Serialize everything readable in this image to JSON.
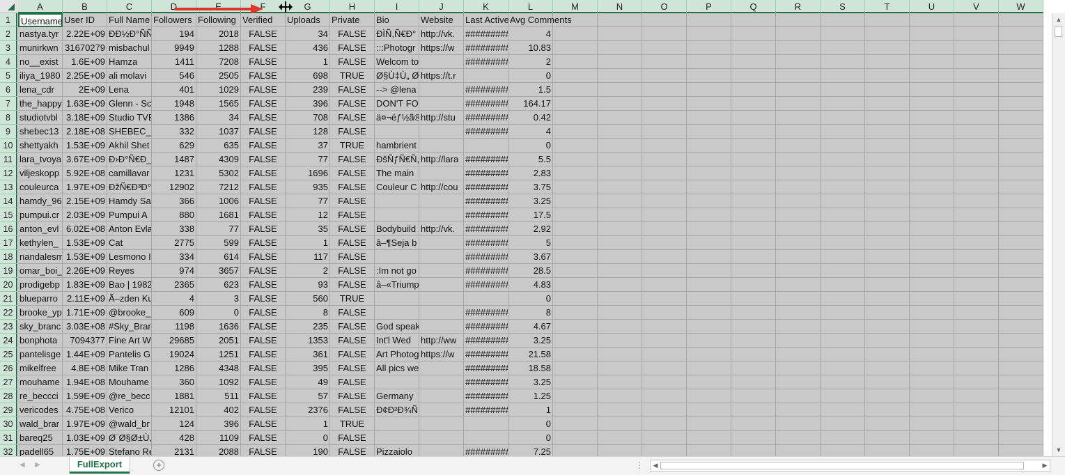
{
  "workbook": {
    "sheet_tab": "FullExport",
    "add_sheet_label": "+",
    "tab_dots": "⋮",
    "accent": "#217346"
  },
  "columns": [
    "A",
    "B",
    "C",
    "D",
    "E",
    "F",
    "G",
    "H",
    "I",
    "J",
    "K",
    "L",
    "M",
    "N",
    "O",
    "P",
    "Q",
    "R",
    "S",
    "T",
    "U",
    "V",
    "W"
  ],
  "headers": [
    "Username",
    "User ID",
    "Full Name",
    "Followers",
    "Following",
    "Verified",
    "Uploads",
    "Private",
    "Bio",
    "Website",
    "Last Active",
    "Avg Comments"
  ],
  "rows": [
    [
      "nastya.tyr",
      "2.22E+09",
      "ÐÐ½Ð°ÑÑ",
      "194",
      "2018",
      "FALSE",
      "34",
      "FALSE",
      "ÐÌÑ,Ñ€Ð°",
      "http://vk.",
      "#########",
      "4"
    ],
    [
      "munirkwn",
      "31670279",
      "misbachul",
      "9949",
      "1288",
      "FALSE",
      "436",
      "FALSE",
      ":::Photogr",
      "https://w",
      "#########",
      "10.83"
    ],
    [
      "no__exist",
      "1.6E+09",
      "Hamza",
      "1411",
      "7208",
      "FALSE",
      "1",
      "FALSE",
      "Welcom to",
      "",
      "#########",
      "2"
    ],
    [
      "iliya_1980",
      "2.25E+09",
      "ali molavi",
      "546",
      "2505",
      "FALSE",
      "698",
      "TRUE",
      "Ø§Ù‡Ù„ Ø",
      "https://t.r",
      "",
      "0"
    ],
    [
      "lena_cdr",
      "2E+09",
      "Lena",
      "401",
      "1029",
      "FALSE",
      "239",
      "FALSE",
      "--> @lena",
      "",
      "#########",
      "1.5"
    ],
    [
      "the_happy",
      "1.63E+09",
      "Glenn - Sc",
      "1948",
      "1565",
      "FALSE",
      "396",
      "FALSE",
      "DON'T FOL",
      "",
      "#########",
      "164.17"
    ],
    [
      "studiotvbl",
      "3.18E+09",
      "Studio TVB",
      "1386",
      "34",
      "FALSE",
      "708",
      "FALSE",
      "ä¤¬éƒ½ã®ä",
      "http://stu",
      "#########",
      "0.42"
    ],
    [
      "shebec13",
      "2.18E+08",
      "SHEBEC_â",
      "332",
      "1037",
      "FALSE",
      "128",
      "FALSE",
      "",
      "",
      "#########",
      "4"
    ],
    [
      "shettyakh",
      "1.53E+09",
      "Akhil Shet",
      "629",
      "635",
      "FALSE",
      "37",
      "TRUE",
      "hambrient",
      "",
      "",
      "0"
    ],
    [
      "lara_tvoya",
      "3.67E+09",
      "Ð›Ð°Ñ€Ð_",
      "1487",
      "4309",
      "FALSE",
      "77",
      "FALSE",
      "ÐšÑƒÑ€Ñ,",
      "http://lara",
      "#########",
      "5.5"
    ],
    [
      "viljeskopp",
      "5.92E+08",
      "camillavar",
      "1231",
      "5302",
      "FALSE",
      "1696",
      "FALSE",
      "The main",
      "",
      "#########",
      "2.83"
    ],
    [
      "couleurca",
      "1.97E+09",
      "ÐžÑ€Ð³Ð°",
      "12902",
      "7212",
      "FALSE",
      "935",
      "FALSE",
      "Couleur C",
      "http://cou",
      "#########",
      "3.75"
    ],
    [
      "hamdy_96",
      "2.15E+09",
      "Hamdy Sa",
      "366",
      "1006",
      "FALSE",
      "77",
      "FALSE",
      "",
      "",
      "#########",
      "3.25"
    ],
    [
      "pumpui.cr",
      "2.03E+09",
      "Pumpui A",
      "880",
      "1681",
      "FALSE",
      "12",
      "FALSE",
      "",
      "",
      "#########",
      "17.5"
    ],
    [
      "anton_evl",
      "6.02E+08",
      "Anton Evla",
      "338",
      "77",
      "FALSE",
      "35",
      "FALSE",
      "Bodybuild",
      "http://vk.",
      "#########",
      "2.92"
    ],
    [
      "kethylen_",
      "1.53E+09",
      "Cat",
      "2775",
      "599",
      "FALSE",
      "1",
      "FALSE",
      "â–¶Seja b",
      "",
      "#########",
      "5"
    ],
    [
      "nandalesm",
      "1.53E+09",
      "Lesmono I",
      "334",
      "614",
      "FALSE",
      "117",
      "FALSE",
      "",
      "",
      "#########",
      "3.67"
    ],
    [
      "omar_boi_",
      "2.26E+09",
      "Reyes",
      "974",
      "3657",
      "FALSE",
      "2",
      "FALSE",
      ":Im not go",
      "",
      "#########",
      "28.5"
    ],
    [
      "prodigebp",
      "1.83E+09",
      "Bao | 1982",
      "2365",
      "623",
      "FALSE",
      "93",
      "FALSE",
      "â–«Triump",
      "",
      "#########",
      "4.83"
    ],
    [
      "blueparro",
      "2.11E+09",
      "Ã–zden Ku",
      "4",
      "3",
      "FALSE",
      "560",
      "TRUE",
      "",
      "",
      "",
      "0"
    ],
    [
      "brooke_yp",
      "1.71E+09",
      "@brooke_",
      "609",
      "0",
      "FALSE",
      "8",
      "FALSE",
      "",
      "",
      "#########",
      "8"
    ],
    [
      "sky_branc",
      "3.03E+08",
      "#Sky_Bran",
      "1198",
      "1636",
      "FALSE",
      "235",
      "FALSE",
      "God speak",
      "",
      "#########",
      "4.67"
    ],
    [
      "bonphota",
      "7094377",
      "Fine Art W",
      "29685",
      "2051",
      "FALSE",
      "1353",
      "FALSE",
      " Int'l Wed",
      "http://ww",
      "#########",
      "3.25"
    ],
    [
      "pantelisge",
      "1.44E+09",
      "Pantelis G",
      "19024",
      "1251",
      "FALSE",
      "361",
      "FALSE",
      "Art Photog",
      "https://w",
      "#########",
      "21.58"
    ],
    [
      "mikelfree",
      "4.8E+08",
      "Mike Tran",
      "1286",
      "4348",
      "FALSE",
      "395",
      "FALSE",
      "All pics we",
      "",
      "#########",
      "18.58"
    ],
    [
      "mouhame",
      "1.94E+08",
      "Mouhame",
      "360",
      "1092",
      "FALSE",
      "49",
      "FALSE",
      "",
      "",
      "#########",
      "3.25"
    ],
    [
      "re_beccci",
      "1.59E+09",
      "@re_becc",
      "1881",
      "511",
      "FALSE",
      "57",
      "FALSE",
      "Germany",
      "",
      "#########",
      "1.25"
    ],
    [
      "vericodes",
      "4.75E+08",
      "Verico",
      "12101",
      "402",
      "FALSE",
      "2376",
      "FALSE",
      "Ð¢Ð²Ð¾Ñ",
      "",
      "#########",
      "1"
    ],
    [
      "wald_brar",
      "1.97E+09",
      "@wald_br",
      "124",
      "396",
      "FALSE",
      "1",
      "TRUE",
      "",
      "",
      "",
      "0"
    ],
    [
      "bareq25",
      "1.03E+09",
      "Ø¨Ø§Ø±Ù‚",
      "428",
      "1109",
      "FALSE",
      "0",
      "FALSE",
      "",
      "",
      "",
      "0"
    ],
    [
      "padell65",
      "1.75E+09",
      "Stefano Re",
      "2131",
      "2088",
      "FALSE",
      "190",
      "FALSE",
      "Pizzaiolo",
      "",
      "#########",
      "7.25"
    ]
  ]
}
